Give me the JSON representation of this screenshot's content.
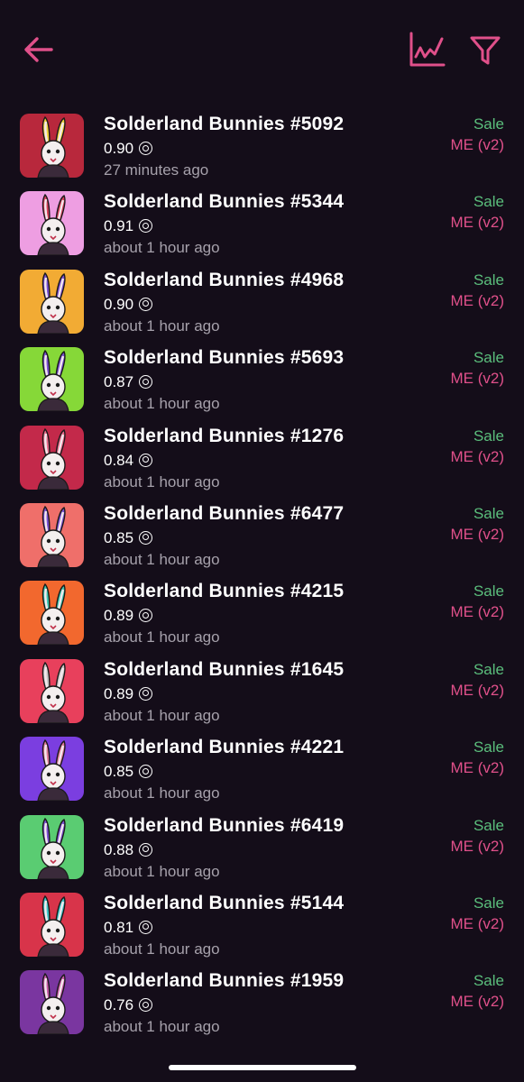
{
  "header": {
    "back_icon": "arrow-left-icon",
    "chart_icon": "line-chart-icon",
    "filter_icon": "filter-icon",
    "accent_color": "#e0508a"
  },
  "currency_icon": "solana-coin-icon",
  "colors": {
    "background": "#140d19",
    "sale": "#5bbe7c",
    "market": "#e0508a",
    "secondary_text": "#a6a1ab"
  },
  "sales": [
    {
      "name": "Solderland Bunnies #5092",
      "price": "0.90",
      "time": "27 minutes ago",
      "type": "Sale",
      "market": "ME (v2)",
      "bg": "#b8283c",
      "ears": "#f2d33c"
    },
    {
      "name": "Solderland Bunnies #5344",
      "price": "0.91",
      "time": "about 1 hour ago",
      "type": "Sale",
      "market": "ME (v2)",
      "bg": "#ee9ee2",
      "ears": "#d6405a"
    },
    {
      "name": "Solderland Bunnies #4968",
      "price": "0.90",
      "time": "about 1 hour ago",
      "type": "Sale",
      "market": "ME (v2)",
      "bg": "#f2ab34",
      "ears": "#7a4fd0"
    },
    {
      "name": "Solderland Bunnies #5693",
      "price": "0.87",
      "time": "about 1 hour ago",
      "type": "Sale",
      "market": "ME (v2)",
      "bg": "#86d838",
      "ears": "#7a4fd0"
    },
    {
      "name": "Solderland Bunnies #1276",
      "price": "0.84",
      "time": "about 1 hour ago",
      "type": "Sale",
      "market": "ME (v2)",
      "bg": "#c3294a",
      "ears": "#e86a8a"
    },
    {
      "name": "Solderland Bunnies #6477",
      "price": "0.85",
      "time": "about 1 hour ago",
      "type": "Sale",
      "market": "ME (v2)",
      "bg": "#ef6f6a",
      "ears": "#7a4fd0"
    },
    {
      "name": "Solderland Bunnies #4215",
      "price": "0.89",
      "time": "about 1 hour ago",
      "type": "Sale",
      "market": "ME (v2)",
      "bg": "#f2682e",
      "ears": "#3fc6b0"
    },
    {
      "name": "Solderland Bunnies #1645",
      "price": "0.89",
      "time": "about 1 hour ago",
      "type": "Sale",
      "market": "ME (v2)",
      "bg": "#e8405c",
      "ears": "#c9c4c4"
    },
    {
      "name": "Solderland Bunnies #4221",
      "price": "0.85",
      "time": "about 1 hour ago",
      "type": "Sale",
      "market": "ME (v2)",
      "bg": "#7b3ee0",
      "ears": "#e07a9a"
    },
    {
      "name": "Solderland Bunnies #6419",
      "price": "0.88",
      "time": "about 1 hour ago",
      "type": "Sale",
      "market": "ME (v2)",
      "bg": "#5acc72",
      "ears": "#7a4fd0"
    },
    {
      "name": "Solderland Bunnies #5144",
      "price": "0.81",
      "time": "about 1 hour ago",
      "type": "Sale",
      "market": "ME (v2)",
      "bg": "#d8344a",
      "ears": "#3fc6c8"
    },
    {
      "name": "Solderland Bunnies #1959",
      "price": "0.76",
      "time": "about 1 hour ago",
      "type": "Sale",
      "market": "ME (v2)",
      "bg": "#7a36a0",
      "ears": "#c85aa8"
    }
  ]
}
